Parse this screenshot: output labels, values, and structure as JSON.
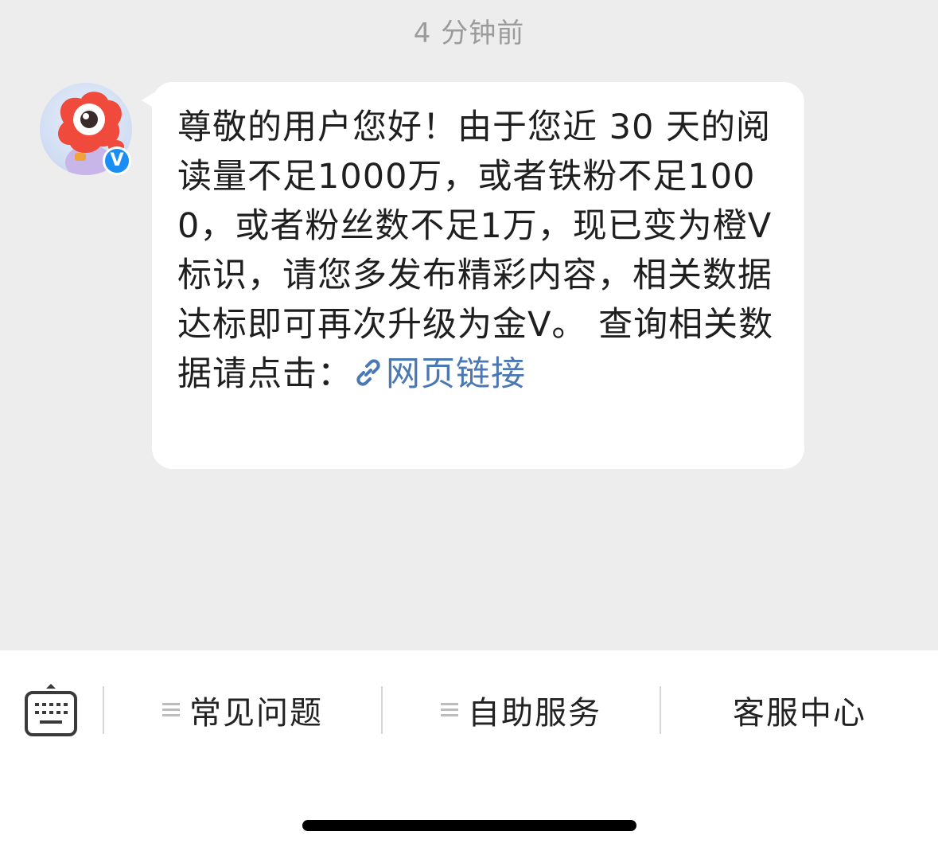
{
  "timestamp": "4 分钟前",
  "sender": {
    "avatar_icon": "weibo-mascot-avatar",
    "verified_badge": "V",
    "verified_color": "#1a8ef5"
  },
  "message": {
    "text": "尊敬的用户您好！由于您近 30 天的阅读量不足1000万，或者铁粉不足1000，或者粉丝数不足1万，现已变为橙V标识，请您多发布精彩内容，相关数据达标即可再次升级为金V。 查询相关数据请点击：",
    "link_icon": "link-icon",
    "link_text": "网页链接",
    "link_color": "#4b78b3"
  },
  "bottom_menu": {
    "keyboard_icon": "keyboard-icon",
    "items": [
      {
        "label": "常见问题",
        "icon": "menu-lines-icon"
      },
      {
        "label": "自助服务",
        "icon": "menu-lines-icon"
      },
      {
        "label": "客服中心"
      }
    ]
  }
}
